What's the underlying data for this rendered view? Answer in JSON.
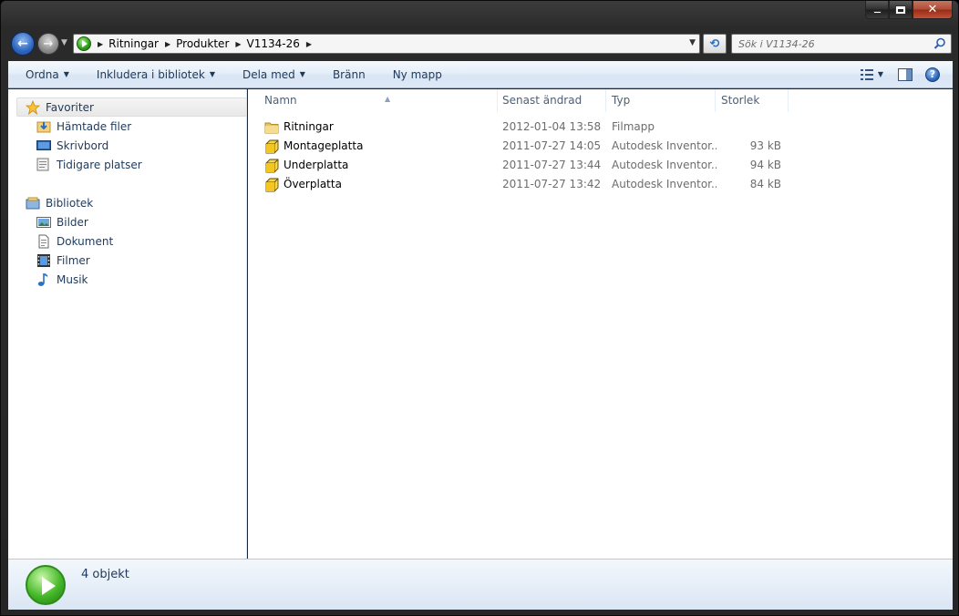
{
  "window": {
    "caption_buttons": [
      "minimize",
      "maximize",
      "close"
    ]
  },
  "address": {
    "breadcrumbs": [
      "Ritningar",
      "Produkter",
      "V1134-26"
    ],
    "search_placeholder": "Sök i V1134-26"
  },
  "toolbar": {
    "ordna_label": "Ordna",
    "inkludera_label": "Inkludera i bibliotek",
    "dela_label": "Dela med",
    "branna_label": "Bränn",
    "nymapp_label": "Ny mapp"
  },
  "nav": {
    "favorites_header": "Favoriter",
    "favorites": [
      "Hämtade filer",
      "Skrivbord",
      "Tidigare platser"
    ],
    "libraries_header": "Bibliotek",
    "libraries": [
      "Bilder",
      "Dokument",
      "Filmer",
      "Musik"
    ]
  },
  "columns": {
    "name": "Namn",
    "modified": "Senast ändrad",
    "type": "Typ",
    "size": "Storlek"
  },
  "files": [
    {
      "name": "Ritningar",
      "modified": "2012-01-04 13:58",
      "type": "Filmapp",
      "size": "",
      "icon": "folder-icon"
    },
    {
      "name": "Montageplatta",
      "modified": "2011-07-27 14:05",
      "type": "Autodesk Inventor...",
      "size": "93 kB",
      "icon": "inventor-part-icon"
    },
    {
      "name": "Underplatta",
      "modified": "2011-07-27 13:44",
      "type": "Autodesk Inventor...",
      "size": "94 kB",
      "icon": "inventor-part-icon"
    },
    {
      "name": "Överplatta",
      "modified": "2011-07-27 13:42",
      "type": "Autodesk Inventor...",
      "size": "84 kB",
      "icon": "inventor-part-icon"
    }
  ],
  "status": {
    "count_text": "4 objekt"
  },
  "colors": {
    "accent": "#1e395b",
    "selection_bg": "#e8e8e8",
    "window_frame": "#2a2a2a"
  }
}
